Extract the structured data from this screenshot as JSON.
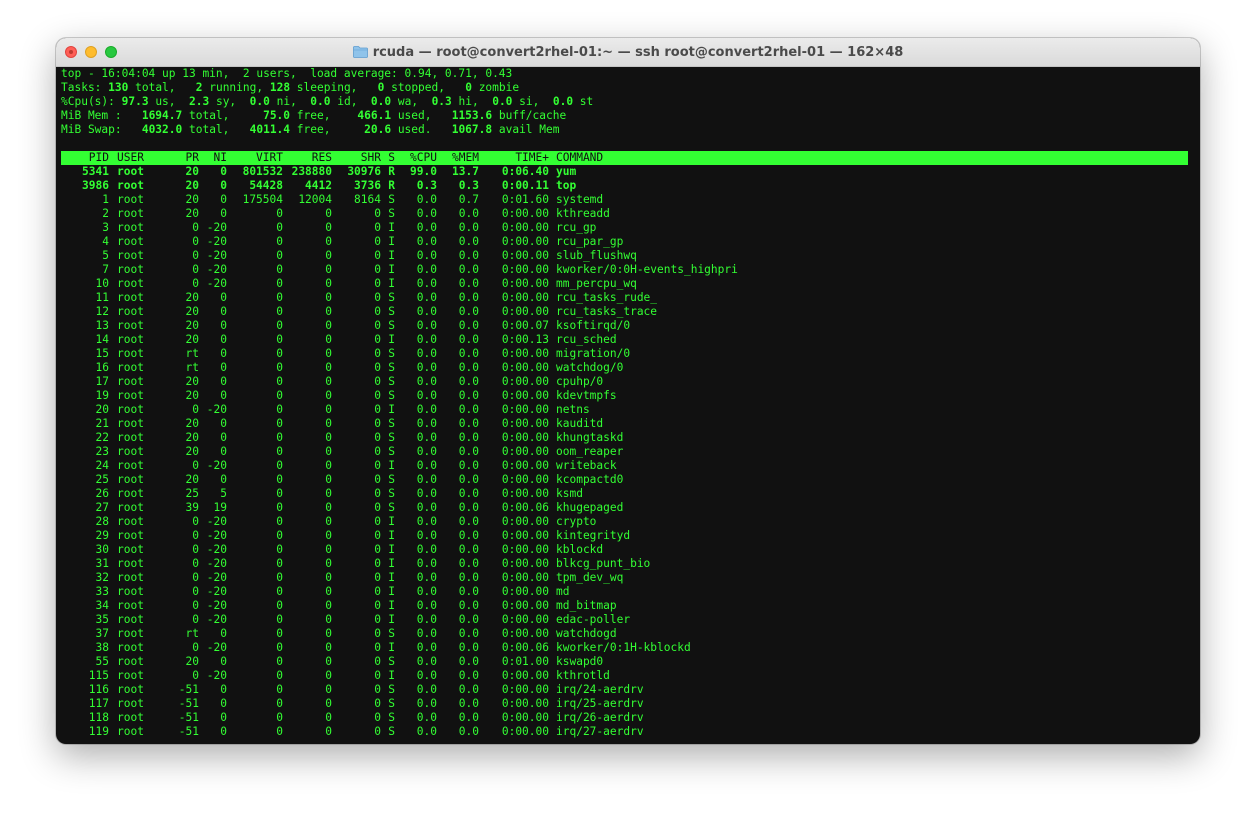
{
  "window": {
    "title": "rcuda — root@convert2rhel-01:~ — ssh root@convert2rhel-01 — 162×48",
    "folder_icon": "folder-icon"
  },
  "summary": {
    "line1": "top - 16:04:04 up 13 min,  2 users,  load average: 0.94, 0.71, 0.43",
    "tasks": {
      "label": "Tasks: ",
      "total": "130",
      "total_lbl": " total,   ",
      "running": "2",
      "running_lbl": " running, ",
      "sleeping": "128",
      "sleeping_lbl": " sleeping,   ",
      "stopped": "0",
      "stopped_lbl": " stopped,   ",
      "zombie": "0",
      "zombie_lbl": " zombie"
    },
    "cpu": {
      "label": "%Cpu(s): ",
      "us": "97.3",
      "us_lbl": " us,  ",
      "sy": "2.3",
      "sy_lbl": " sy,  ",
      "ni": "0.0",
      "ni_lbl": " ni,  ",
      "id": "0.0",
      "id_lbl": " id,  ",
      "wa": "0.0",
      "wa_lbl": " wa,  ",
      "hi": "0.3",
      "hi_lbl": " hi,  ",
      "si": "0.0",
      "si_lbl": " si,  ",
      "st": "0.0",
      "st_lbl": " st"
    },
    "mem": {
      "label": "MiB Mem :   ",
      "total": "1694.7",
      "total_lbl": " total,     ",
      "free": "75.0",
      "free_lbl": " free,    ",
      "used": "466.1",
      "used_lbl": " used,   ",
      "buff": "1153.6",
      "buff_lbl": " buff/cache"
    },
    "swap": {
      "label": "MiB Swap:   ",
      "total": "4032.0",
      "total_lbl": " total,   ",
      "free": "4011.4",
      "free_lbl": " free,     ",
      "used": "20.6",
      "used_lbl": " used.   ",
      "avail": "1067.8",
      "avail_lbl": " avail Mem"
    }
  },
  "columns": [
    "PID",
    "USER",
    "PR",
    "NI",
    "VIRT",
    "RES",
    "SHR",
    "S",
    "%CPU",
    "%MEM",
    "TIME+",
    "COMMAND"
  ],
  "processes": [
    {
      "pid": "5341",
      "user": "root",
      "pr": "20",
      "ni": "0",
      "virt": "801532",
      "res": "238880",
      "shr": "30976",
      "s": "R",
      "cpu": "99.0",
      "mem": "13.7",
      "time": "0:06.40",
      "cmd": "yum",
      "hl": true
    },
    {
      "pid": "3986",
      "user": "root",
      "pr": "20",
      "ni": "0",
      "virt": "54428",
      "res": "4412",
      "shr": "3736",
      "s": "R",
      "cpu": "0.3",
      "mem": "0.3",
      "time": "0:00.11",
      "cmd": "top",
      "hl": true
    },
    {
      "pid": "1",
      "user": "root",
      "pr": "20",
      "ni": "0",
      "virt": "175504",
      "res": "12004",
      "shr": "8164",
      "s": "S",
      "cpu": "0.0",
      "mem": "0.7",
      "time": "0:01.60",
      "cmd": "systemd"
    },
    {
      "pid": "2",
      "user": "root",
      "pr": "20",
      "ni": "0",
      "virt": "0",
      "res": "0",
      "shr": "0",
      "s": "S",
      "cpu": "0.0",
      "mem": "0.0",
      "time": "0:00.00",
      "cmd": "kthreadd"
    },
    {
      "pid": "3",
      "user": "root",
      "pr": "0",
      "ni": "-20",
      "virt": "0",
      "res": "0",
      "shr": "0",
      "s": "I",
      "cpu": "0.0",
      "mem": "0.0",
      "time": "0:00.00",
      "cmd": "rcu_gp"
    },
    {
      "pid": "4",
      "user": "root",
      "pr": "0",
      "ni": "-20",
      "virt": "0",
      "res": "0",
      "shr": "0",
      "s": "I",
      "cpu": "0.0",
      "mem": "0.0",
      "time": "0:00.00",
      "cmd": "rcu_par_gp"
    },
    {
      "pid": "5",
      "user": "root",
      "pr": "0",
      "ni": "-20",
      "virt": "0",
      "res": "0",
      "shr": "0",
      "s": "I",
      "cpu": "0.0",
      "mem": "0.0",
      "time": "0:00.00",
      "cmd": "slub_flushwq"
    },
    {
      "pid": "7",
      "user": "root",
      "pr": "0",
      "ni": "-20",
      "virt": "0",
      "res": "0",
      "shr": "0",
      "s": "I",
      "cpu": "0.0",
      "mem": "0.0",
      "time": "0:00.00",
      "cmd": "kworker/0:0H-events_highpri"
    },
    {
      "pid": "10",
      "user": "root",
      "pr": "0",
      "ni": "-20",
      "virt": "0",
      "res": "0",
      "shr": "0",
      "s": "I",
      "cpu": "0.0",
      "mem": "0.0",
      "time": "0:00.00",
      "cmd": "mm_percpu_wq"
    },
    {
      "pid": "11",
      "user": "root",
      "pr": "20",
      "ni": "0",
      "virt": "0",
      "res": "0",
      "shr": "0",
      "s": "S",
      "cpu": "0.0",
      "mem": "0.0",
      "time": "0:00.00",
      "cmd": "rcu_tasks_rude_"
    },
    {
      "pid": "12",
      "user": "root",
      "pr": "20",
      "ni": "0",
      "virt": "0",
      "res": "0",
      "shr": "0",
      "s": "S",
      "cpu": "0.0",
      "mem": "0.0",
      "time": "0:00.00",
      "cmd": "rcu_tasks_trace"
    },
    {
      "pid": "13",
      "user": "root",
      "pr": "20",
      "ni": "0",
      "virt": "0",
      "res": "0",
      "shr": "0",
      "s": "S",
      "cpu": "0.0",
      "mem": "0.0",
      "time": "0:00.07",
      "cmd": "ksoftirqd/0"
    },
    {
      "pid": "14",
      "user": "root",
      "pr": "20",
      "ni": "0",
      "virt": "0",
      "res": "0",
      "shr": "0",
      "s": "I",
      "cpu": "0.0",
      "mem": "0.0",
      "time": "0:00.13",
      "cmd": "rcu_sched"
    },
    {
      "pid": "15",
      "user": "root",
      "pr": "rt",
      "ni": "0",
      "virt": "0",
      "res": "0",
      "shr": "0",
      "s": "S",
      "cpu": "0.0",
      "mem": "0.0",
      "time": "0:00.00",
      "cmd": "migration/0"
    },
    {
      "pid": "16",
      "user": "root",
      "pr": "rt",
      "ni": "0",
      "virt": "0",
      "res": "0",
      "shr": "0",
      "s": "S",
      "cpu": "0.0",
      "mem": "0.0",
      "time": "0:00.00",
      "cmd": "watchdog/0"
    },
    {
      "pid": "17",
      "user": "root",
      "pr": "20",
      "ni": "0",
      "virt": "0",
      "res": "0",
      "shr": "0",
      "s": "S",
      "cpu": "0.0",
      "mem": "0.0",
      "time": "0:00.00",
      "cmd": "cpuhp/0"
    },
    {
      "pid": "19",
      "user": "root",
      "pr": "20",
      "ni": "0",
      "virt": "0",
      "res": "0",
      "shr": "0",
      "s": "S",
      "cpu": "0.0",
      "mem": "0.0",
      "time": "0:00.00",
      "cmd": "kdevtmpfs"
    },
    {
      "pid": "20",
      "user": "root",
      "pr": "0",
      "ni": "-20",
      "virt": "0",
      "res": "0",
      "shr": "0",
      "s": "I",
      "cpu": "0.0",
      "mem": "0.0",
      "time": "0:00.00",
      "cmd": "netns"
    },
    {
      "pid": "21",
      "user": "root",
      "pr": "20",
      "ni": "0",
      "virt": "0",
      "res": "0",
      "shr": "0",
      "s": "S",
      "cpu": "0.0",
      "mem": "0.0",
      "time": "0:00.00",
      "cmd": "kauditd"
    },
    {
      "pid": "22",
      "user": "root",
      "pr": "20",
      "ni": "0",
      "virt": "0",
      "res": "0",
      "shr": "0",
      "s": "S",
      "cpu": "0.0",
      "mem": "0.0",
      "time": "0:00.00",
      "cmd": "khungtaskd"
    },
    {
      "pid": "23",
      "user": "root",
      "pr": "20",
      "ni": "0",
      "virt": "0",
      "res": "0",
      "shr": "0",
      "s": "S",
      "cpu": "0.0",
      "mem": "0.0",
      "time": "0:00.00",
      "cmd": "oom_reaper"
    },
    {
      "pid": "24",
      "user": "root",
      "pr": "0",
      "ni": "-20",
      "virt": "0",
      "res": "0",
      "shr": "0",
      "s": "I",
      "cpu": "0.0",
      "mem": "0.0",
      "time": "0:00.00",
      "cmd": "writeback"
    },
    {
      "pid": "25",
      "user": "root",
      "pr": "20",
      "ni": "0",
      "virt": "0",
      "res": "0",
      "shr": "0",
      "s": "S",
      "cpu": "0.0",
      "mem": "0.0",
      "time": "0:00.00",
      "cmd": "kcompactd0"
    },
    {
      "pid": "26",
      "user": "root",
      "pr": "25",
      "ni": "5",
      "virt": "0",
      "res": "0",
      "shr": "0",
      "s": "S",
      "cpu": "0.0",
      "mem": "0.0",
      "time": "0:00.00",
      "cmd": "ksmd"
    },
    {
      "pid": "27",
      "user": "root",
      "pr": "39",
      "ni": "19",
      "virt": "0",
      "res": "0",
      "shr": "0",
      "s": "S",
      "cpu": "0.0",
      "mem": "0.0",
      "time": "0:00.06",
      "cmd": "khugepaged"
    },
    {
      "pid": "28",
      "user": "root",
      "pr": "0",
      "ni": "-20",
      "virt": "0",
      "res": "0",
      "shr": "0",
      "s": "I",
      "cpu": "0.0",
      "mem": "0.0",
      "time": "0:00.00",
      "cmd": "crypto"
    },
    {
      "pid": "29",
      "user": "root",
      "pr": "0",
      "ni": "-20",
      "virt": "0",
      "res": "0",
      "shr": "0",
      "s": "I",
      "cpu": "0.0",
      "mem": "0.0",
      "time": "0:00.00",
      "cmd": "kintegrityd"
    },
    {
      "pid": "30",
      "user": "root",
      "pr": "0",
      "ni": "-20",
      "virt": "0",
      "res": "0",
      "shr": "0",
      "s": "I",
      "cpu": "0.0",
      "mem": "0.0",
      "time": "0:00.00",
      "cmd": "kblockd"
    },
    {
      "pid": "31",
      "user": "root",
      "pr": "0",
      "ni": "-20",
      "virt": "0",
      "res": "0",
      "shr": "0",
      "s": "I",
      "cpu": "0.0",
      "mem": "0.0",
      "time": "0:00.00",
      "cmd": "blkcg_punt_bio"
    },
    {
      "pid": "32",
      "user": "root",
      "pr": "0",
      "ni": "-20",
      "virt": "0",
      "res": "0",
      "shr": "0",
      "s": "I",
      "cpu": "0.0",
      "mem": "0.0",
      "time": "0:00.00",
      "cmd": "tpm_dev_wq"
    },
    {
      "pid": "33",
      "user": "root",
      "pr": "0",
      "ni": "-20",
      "virt": "0",
      "res": "0",
      "shr": "0",
      "s": "I",
      "cpu": "0.0",
      "mem": "0.0",
      "time": "0:00.00",
      "cmd": "md"
    },
    {
      "pid": "34",
      "user": "root",
      "pr": "0",
      "ni": "-20",
      "virt": "0",
      "res": "0",
      "shr": "0",
      "s": "I",
      "cpu": "0.0",
      "mem": "0.0",
      "time": "0:00.00",
      "cmd": "md_bitmap"
    },
    {
      "pid": "35",
      "user": "root",
      "pr": "0",
      "ni": "-20",
      "virt": "0",
      "res": "0",
      "shr": "0",
      "s": "I",
      "cpu": "0.0",
      "mem": "0.0",
      "time": "0:00.00",
      "cmd": "edac-poller"
    },
    {
      "pid": "37",
      "user": "root",
      "pr": "rt",
      "ni": "0",
      "virt": "0",
      "res": "0",
      "shr": "0",
      "s": "S",
      "cpu": "0.0",
      "mem": "0.0",
      "time": "0:00.00",
      "cmd": "watchdogd"
    },
    {
      "pid": "38",
      "user": "root",
      "pr": "0",
      "ni": "-20",
      "virt": "0",
      "res": "0",
      "shr": "0",
      "s": "I",
      "cpu": "0.0",
      "mem": "0.0",
      "time": "0:00.06",
      "cmd": "kworker/0:1H-kblockd"
    },
    {
      "pid": "55",
      "user": "root",
      "pr": "20",
      "ni": "0",
      "virt": "0",
      "res": "0",
      "shr": "0",
      "s": "S",
      "cpu": "0.0",
      "mem": "0.0",
      "time": "0:01.00",
      "cmd": "kswapd0"
    },
    {
      "pid": "115",
      "user": "root",
      "pr": "0",
      "ni": "-20",
      "virt": "0",
      "res": "0",
      "shr": "0",
      "s": "I",
      "cpu": "0.0",
      "mem": "0.0",
      "time": "0:00.00",
      "cmd": "kthrotld"
    },
    {
      "pid": "116",
      "user": "root",
      "pr": "-51",
      "ni": "0",
      "virt": "0",
      "res": "0",
      "shr": "0",
      "s": "S",
      "cpu": "0.0",
      "mem": "0.0",
      "time": "0:00.00",
      "cmd": "irq/24-aerdrv"
    },
    {
      "pid": "117",
      "user": "root",
      "pr": "-51",
      "ni": "0",
      "virt": "0",
      "res": "0",
      "shr": "0",
      "s": "S",
      "cpu": "0.0",
      "mem": "0.0",
      "time": "0:00.00",
      "cmd": "irq/25-aerdrv"
    },
    {
      "pid": "118",
      "user": "root",
      "pr": "-51",
      "ni": "0",
      "virt": "0",
      "res": "0",
      "shr": "0",
      "s": "S",
      "cpu": "0.0",
      "mem": "0.0",
      "time": "0:00.00",
      "cmd": "irq/26-aerdrv"
    },
    {
      "pid": "119",
      "user": "root",
      "pr": "-51",
      "ni": "0",
      "virt": "0",
      "res": "0",
      "shr": "0",
      "s": "S",
      "cpu": "0.0",
      "mem": "0.0",
      "time": "0:00.00",
      "cmd": "irq/27-aerdrv"
    }
  ],
  "colors": {
    "terminal_fg": "#33ff33",
    "terminal_bg": "#111111"
  }
}
